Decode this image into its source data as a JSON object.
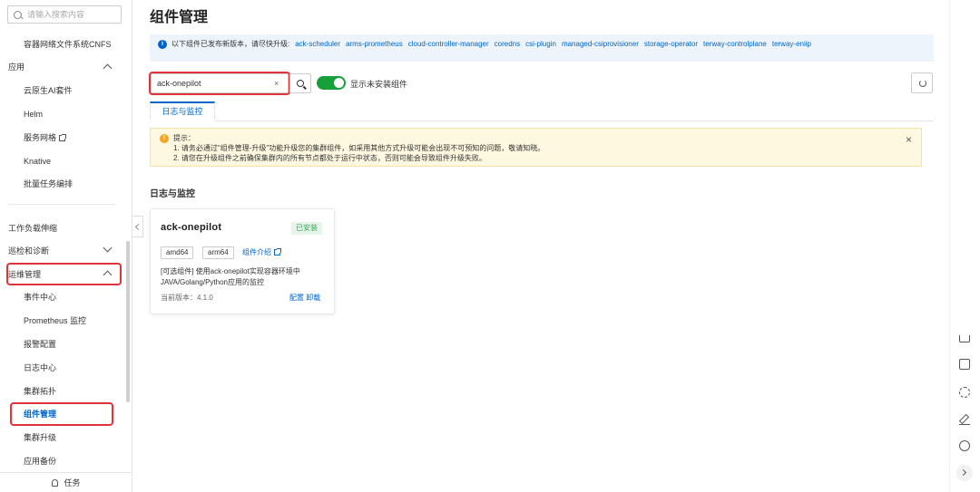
{
  "sidebar": {
    "search_placeholder": "请输入搜索内容",
    "items": {
      "cnfs": "容器网络文件系统CNFS",
      "apps_group": "应用",
      "ai_suite": "云原生AI套件",
      "helm": "Helm",
      "service_mesh": "服务网格",
      "knative": "Knative",
      "batch_tasks": "批量任务编排",
      "workload_scaling": "工作负载伸缩",
      "inspection_group": "巡检和诊断",
      "ops_group": "运维管理",
      "event_center": "事件中心",
      "prometheus": "Prometheus 监控",
      "alert_config": "报警配置",
      "log_center": "日志中心",
      "cluster_topology": "集群拓扑",
      "component_mgmt": "组件管理",
      "cluster_upgrade": "集群升级",
      "app_backup": "应用备份"
    },
    "tasks_label": "任务"
  },
  "main": {
    "title": "组件管理",
    "notice": {
      "prefix": "以下组件已发布新版本，请尽快升级:",
      "links": [
        "ack-scheduler",
        "arms-prometheus",
        "cloud-controller-manager",
        "coredns",
        "csi-plugin",
        "managed-csiprovisioner",
        "storage-operator",
        "terway-controlplane",
        "terway-eniip"
      ]
    },
    "search_value": "ack-onepilot",
    "clear_label": "×",
    "toggle_label": "显示未安装组件",
    "tab_label": "日志与监控",
    "warning": {
      "title": "提示：",
      "line1": "1. 请务必通过\"组件管理-升级\"功能升级您的集群组件，如采用其他方式升级可能会出现不可预知的问题，敬请知晓。",
      "line2": "2. 请您在升级组件之前确保集群内的所有节点都处于运行中状态，否则可能会导致组件升级失败。",
      "close": "×"
    },
    "section_title": "日志与监控",
    "card": {
      "name": "ack-onepilot",
      "status": "已安装",
      "tags": [
        "amd64",
        "arm64"
      ],
      "intro_link": "组件介绍",
      "desc_tag": "[可选组件]",
      "desc": "使用ack-onepilot实现容器环境中JAVA/Golang/Python应用的监控",
      "version": "当前版本：4.1.0",
      "config": "配置",
      "uninstall": "卸载"
    }
  },
  "colors": {
    "accent": "#0064c8",
    "toggle_on": "#15a03a",
    "highlight_box": "#e0343b",
    "warning_bg": "#fff8e1",
    "notice_bg": "#eef4fb"
  }
}
